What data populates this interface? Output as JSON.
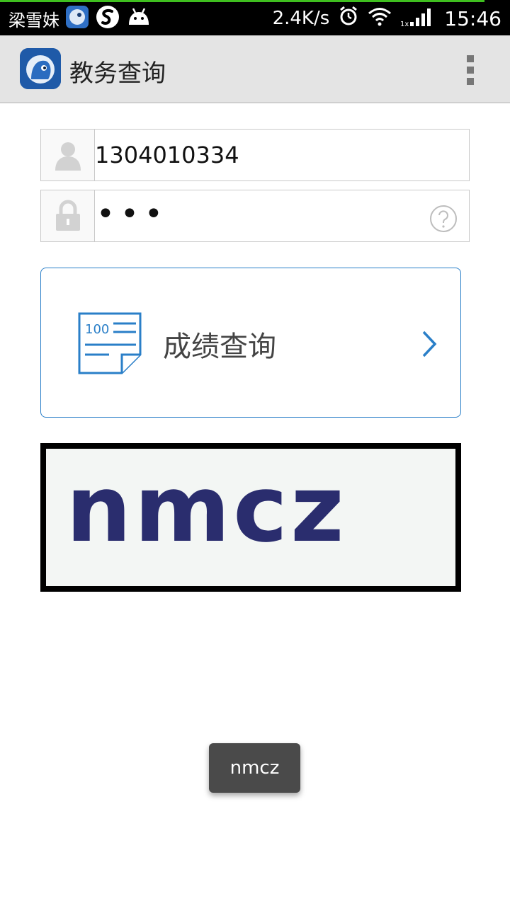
{
  "status_bar": {
    "user_name": "梁雪妹",
    "net_speed": "2.4K/s",
    "time": "15:46",
    "sim_label": "1x",
    "icons": [
      "app-icon",
      "sogou-icon",
      "android-icon",
      "alarm-icon",
      "wifi-icon",
      "signal-icon"
    ]
  },
  "app_bar": {
    "title": "教务查询",
    "menu_icon": "overflow-menu-icon"
  },
  "form": {
    "username": {
      "value": "1304010334",
      "icon": "user-icon"
    },
    "password": {
      "value": "•••",
      "icon": "lock-icon",
      "help_icon": "help-icon"
    }
  },
  "query_card": {
    "label": "成绩查询",
    "icon": "score-document-icon",
    "icon_text": "100",
    "chevron": "chevron-right-icon",
    "border_color": "#2a7fc8"
  },
  "captcha": {
    "text": "nmcz"
  },
  "toast": {
    "text": "nmcz"
  }
}
